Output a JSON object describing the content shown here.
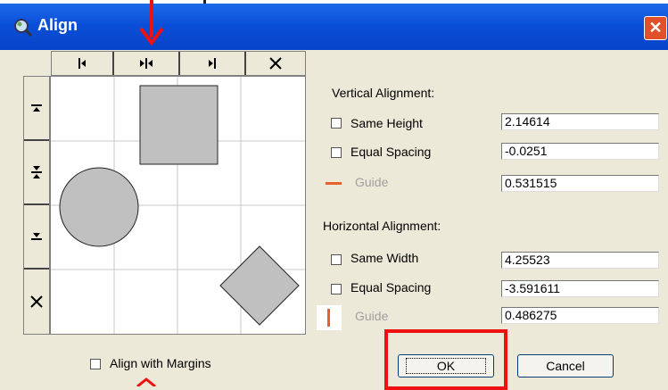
{
  "window": {
    "title": "Align",
    "close_icon": "close-icon",
    "app_icon": "magnifier-app-icon"
  },
  "toolbar_top": {
    "icons": [
      "align-left-icon",
      "align-center-horizontal-icon",
      "align-right-icon",
      "clear-horizontal-icon"
    ]
  },
  "toolbar_left": {
    "icons": [
      "align-top-icon",
      "align-middle-vertical-icon",
      "align-bottom-icon",
      "clear-vertical-icon"
    ]
  },
  "vertical": {
    "heading": "Vertical Alignment:",
    "same_height_label": "Same Height",
    "same_height_value": "2.14614",
    "equal_spacing_label": "Equal Spacing",
    "equal_spacing_value": "-0.0251",
    "guide_label": "Guide",
    "guide_value": "0.531515",
    "guide_color": "#e8602c"
  },
  "horizontal": {
    "heading": "Horizontal Alignment:",
    "same_width_label": "Same Width",
    "same_width_value": "4.25523",
    "equal_spacing_label": "Equal Spacing",
    "equal_spacing_value": "-3.591611",
    "guide_label": "Guide",
    "guide_value": "0.486275",
    "guide_color": "#e8602c"
  },
  "margins_label": "Align with Margins",
  "ok_label": "OK",
  "cancel_label": "Cancel",
  "annotation_color": "#ee1111"
}
